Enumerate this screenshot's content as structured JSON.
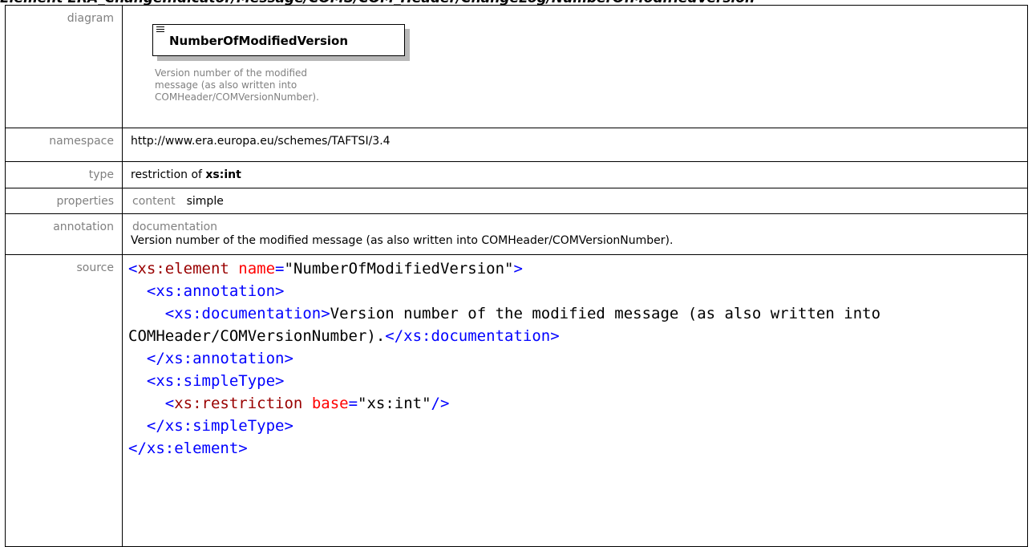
{
  "heading": "Element ERA_ChangeIndicator/Message/COMS/COM_Header/ChangeLog/NumberOfModifiedVersion",
  "labels": {
    "diagram": "diagram",
    "namespace": "namespace",
    "type": "type",
    "properties": "properties",
    "annotation": "annotation",
    "source": "source"
  },
  "diagram": {
    "element_name": "NumberOfModifiedVersion",
    "doc_text": "Version number of the modified message (as also written into COMHeader/COMVersionNumber).",
    "icon": "lines-icon"
  },
  "namespace": "http://www.era.europa.eu/schemes/TAFTSI/3.4",
  "type": {
    "prefix": "restriction of ",
    "base": "xs:int"
  },
  "properties": {
    "key": "content",
    "value": "simple"
  },
  "annotation": {
    "key": "documentation",
    "text": "Version number of the modified message (as also written into COMHeader/COMVersionNumber)."
  },
  "source": {
    "line1_open": "<",
    "line1_tag": "xs:element",
    "line1_attr": " name",
    "line1_eq": "=",
    "line1_val": "\"NumberOfModifiedVersion\"",
    "line1_close": ">",
    "line2": "  <xs:annotation>",
    "line3_tag": "    <xs:documentation>",
    "line3_text": "Version number of the modified message (as also written into COMHeader/COMVersionNumber).",
    "line3_close": "</xs:documentation>",
    "line4": "  </xs:annotation>",
    "line5": "  <xs:simpleType>",
    "line6_open": "    <",
    "line6_tag": "xs:restriction",
    "line6_attr": " base",
    "line6_eq": "=",
    "line6_val": "\"xs:int\"",
    "line6_close": "/>",
    "line7": "  </xs:simpleType>",
    "line8": "</xs:element>"
  }
}
